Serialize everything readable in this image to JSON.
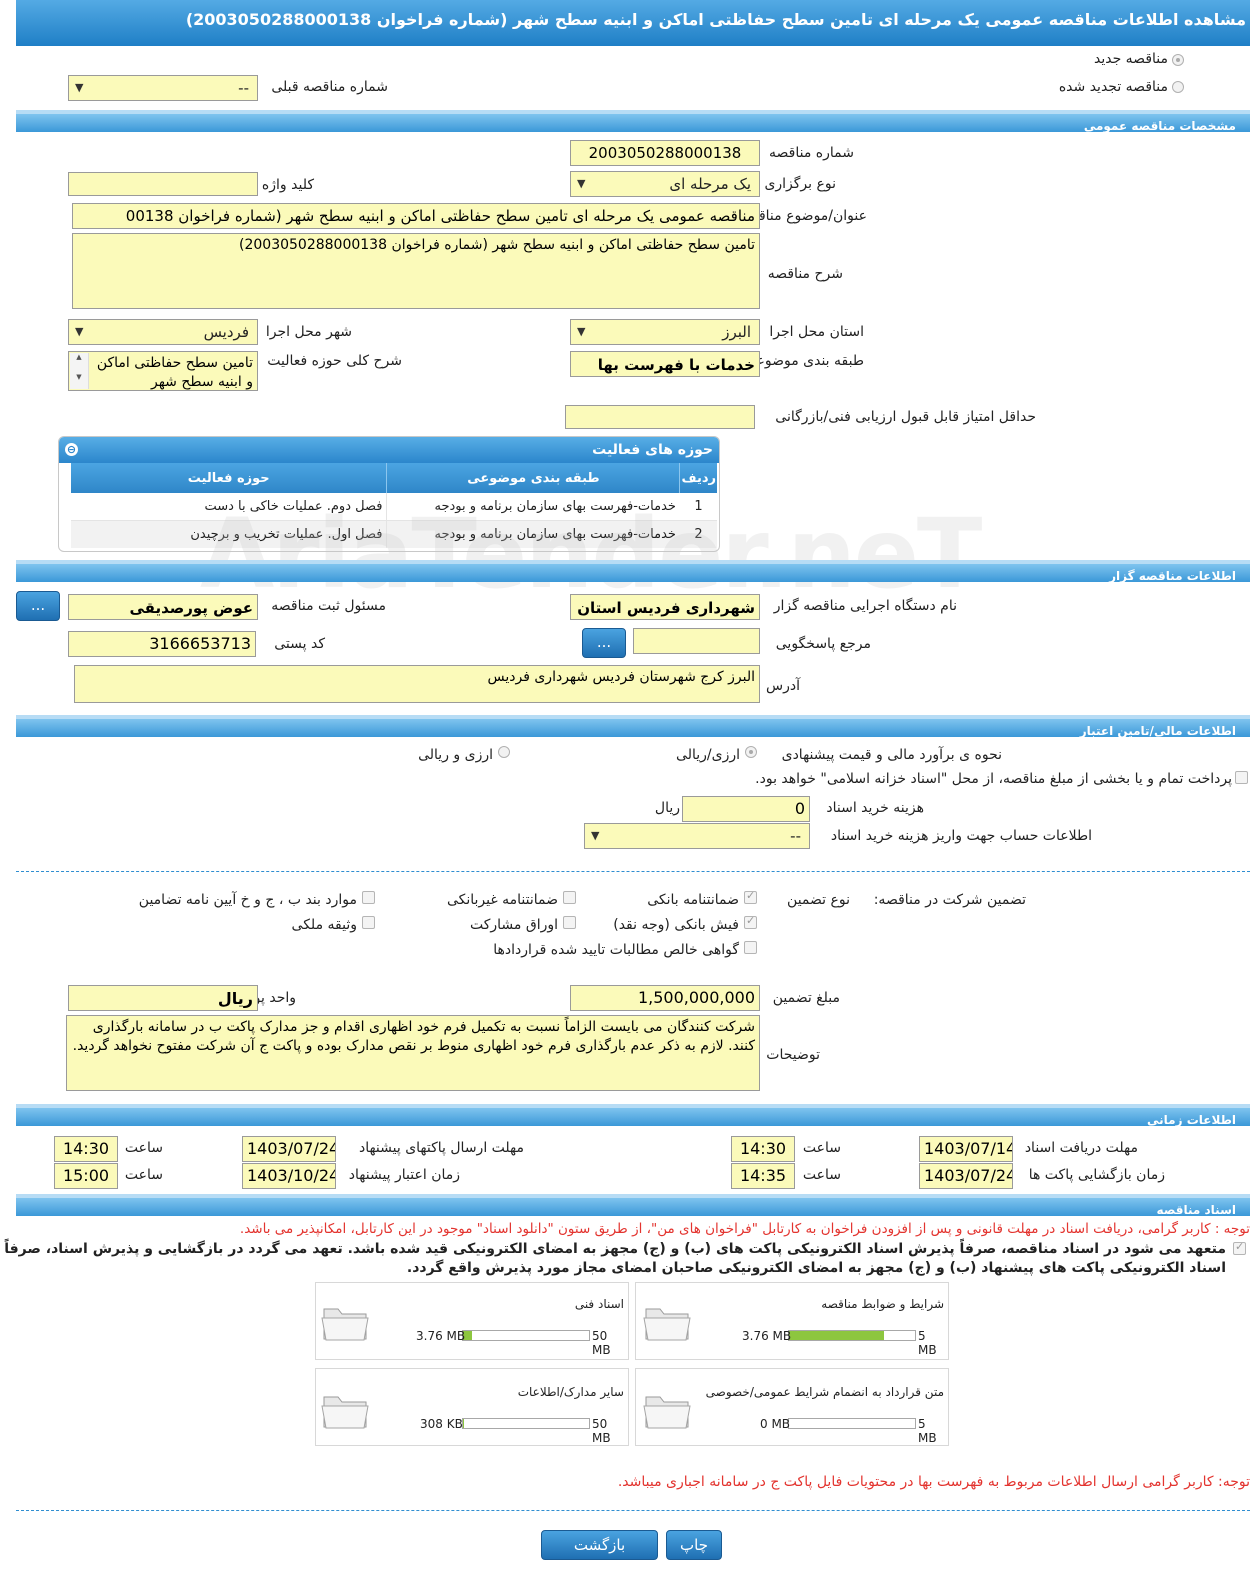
{
  "title": "مشاهده اطلاعات مناقصه عمومی یک مرحله ای تامین سطح حفاظتی اماکن و ابنیه سطح شهر (شماره فراخوان 2003050288000138)",
  "top": {
    "new_tender": "مناقصه جدید",
    "renewed_tender": "مناقصه تجدید شده",
    "prev_number_label": "شماره مناقصه قبلی",
    "prev_number_value": "--"
  },
  "sections": {
    "general": "مشخصات مناقصه عمومی",
    "organizer": "اطلاعات مناقصه گزار",
    "finance": "اطلاعات مالی/تامین اعتبار",
    "timing": "اطلاعات زمانی",
    "documents": "اسناد مناقصه"
  },
  "general": {
    "number_label": "شماره مناقصه",
    "number_value": "2003050288000138",
    "type_label": "نوع برگزاری",
    "type_value": "یک مرحله ای",
    "keyword_label": "کلید واژه",
    "keyword_value": "",
    "subject_label": "عنوان/موضوع مناقصه",
    "subject_value": "مناقصه عمومی یک مرحله ای تامین سطح حفاظتی اماکن و ابنیه سطح شهر (شماره فراخوان 00138",
    "desc_label": "شرح مناقصه",
    "desc_value": "تامین سطح حفاظتی اماکن و ابنیه سطح شهر (شماره فراخوان 2003050288000138)",
    "province_label": "استان محل اجرا",
    "province_value": "البرز",
    "city_label": "شهر محل اجرا",
    "city_value": "فردیس",
    "category_label": "طبقه بندی موضوعی",
    "category_value": "خدمات با فهرست بها",
    "scope_label": "شرح کلی حوزه فعالیت",
    "scope_value": "تامین سطح حفاظتی اماکن و ابنیه سطح شهر",
    "min_score_label": "حداقل امتیاز قابل قبول ارزیابی فنی/بازرگانی",
    "min_score_value": ""
  },
  "activities": {
    "title": "حوزه های فعالیت",
    "headers": [
      "ردیف",
      "طبقه بندی موضوعی",
      "حوزه فعالیت"
    ],
    "rows": [
      [
        "1",
        "خدمات-فهرست بهای سازمان برنامه و بودجه",
        "فصل دوم. عملیات خاکی با دست"
      ],
      [
        "2",
        "خدمات-فهرست بهای سازمان برنامه و بودجه",
        "فصل اول. عملیات تخریب و برچیدن"
      ]
    ]
  },
  "organizer": {
    "org_label": "نام دستگاه اجرایی مناقصه گزار",
    "org_value": "شهرداری فردیس استان البرز",
    "responsible_label": "مسئول ثبت مناقصه",
    "responsible_value": "عوض پورصدیقی",
    "ref_label": "مرجع پاسخگویی",
    "ref_value": "",
    "postal_label": "کد پستی",
    "postal_value": "3166653713",
    "address_label": "آدرس",
    "address_value": "البرز کرج شهرستان فردیس شهرداری فردیس",
    "dots": "..."
  },
  "finance": {
    "method_label": "نحوه ی برآورد مالی و قیمت پیشنهادی",
    "method_opt1": "ارزی/ریالی",
    "method_opt2": "ارزی و ریالی",
    "treasury_text": "پرداخت تمام و یا بخشی از مبلغ مناقصه، از محل \"اسناد خزانه اسلامی\" خواهد بود.",
    "doc_fee_label": "هزینه خرید اسناد",
    "doc_fee_value": "0",
    "doc_fee_unit": "ریال",
    "account_label": "اطلاعات حساب جهت واریز هزینه خرید اسناد",
    "account_value": "--",
    "guarantee_label": "تضمین شرکت در مناقصه:",
    "guarantee_type_label": "نوع تضمین",
    "g_bank": "ضمانتنامه بانکی",
    "g_nonbank": "ضمانتنامه غیربانکی",
    "g_items": "موارد بند ب ، ج و خ آیین نامه تضامین",
    "g_cash": "فیش بانکی (وجه نقد)",
    "g_bonds": "اوراق مشارکت",
    "g_property": "وثیقه ملکی",
    "g_receivables": "گواهی خالص مطالبات تایید شده قراردادها",
    "amount_label": "مبلغ تضمین",
    "amount_value": "1,500,000,000",
    "currency_label": "واحد پول",
    "currency_value": "ریال",
    "notes_label": "توضیحات",
    "notes_value": "شرکت کنندگان می بایست الزاماً نسبت به تکمیل فرم خود اظهاری اقدام و جز مدارک پاکت ب در سامانه بارگذاری کنند. لازم به ذکر عدم بارگذاری فرم خود اظهاری منوط بر نقص مدارک بوده و پاکت ج آن شرکت مفتوح نخواهد گردید."
  },
  "timing": {
    "receive_label": "مهلت دریافت اسناد",
    "receive_date": "1403/07/14",
    "receive_time": "14:30",
    "send_label": "مهلت ارسال پاکتهای پیشنهاد",
    "send_date": "1403/07/24",
    "send_time": "14:30",
    "open_label": "زمان بازگشایی پاکت ها",
    "open_date": "1403/07/24",
    "open_time": "14:35",
    "validity_label": "زمان اعتبار پیشنهاد",
    "validity_date": "1403/10/24",
    "validity_time": "15:00",
    "time_label": "ساعت"
  },
  "documents": {
    "notice": "توجه : کاربر گرامی، دریافت اسناد در مهلت قانونی و پس از افزودن فراخوان به کارتابل \"فراخوان های من\"، از طریق ستون \"دانلود اسناد\" موجود در این کارتابل، امکانپذیر می باشد.",
    "commit": "متعهد می شود در اسناد مناقصه، صرفاً پذیرش اسناد الکترونیکی پاکت های (ب) و (ج) مجهز به امضای الکترونیکی قید شده باشد. تعهد می گردد در بازگشایی و پذیرش اسناد، صرفاً اسناد الکترونیکی پاکت های پیشنهاد (ب) و (ج) مجهز به امضای الکترونیکی صاحبان امضای مجاز مورد پذیرش واقع گردد.",
    "cards": [
      {
        "name": "شرایط و ضوابط مناقصه",
        "used": "3.76 MB",
        "max": "5 MB",
        "fraction": 0.75
      },
      {
        "name": "اسناد فنی",
        "used": "3.76 MB",
        "max": "50 MB",
        "fraction": 0.075
      },
      {
        "name": "متن قرارداد به انضمام شرایط عمومی/خصوصی",
        "used": "0 MB",
        "max": "5 MB",
        "fraction": 0.0
      },
      {
        "name": "سایر مدارک/اطلاعات",
        "used": "308 KB",
        "max": "50 MB",
        "fraction": 0.006
      }
    ],
    "footer_notice": "توجه: کاربر گرامی ارسال اطلاعات مربوط به فهرست بها در محتویات فایل پاکت ج در سامانه اجباری میباشد."
  },
  "buttons": {
    "print": "چاپ",
    "back": "بازگشت"
  },
  "watermark": "AriaTender.neT"
}
